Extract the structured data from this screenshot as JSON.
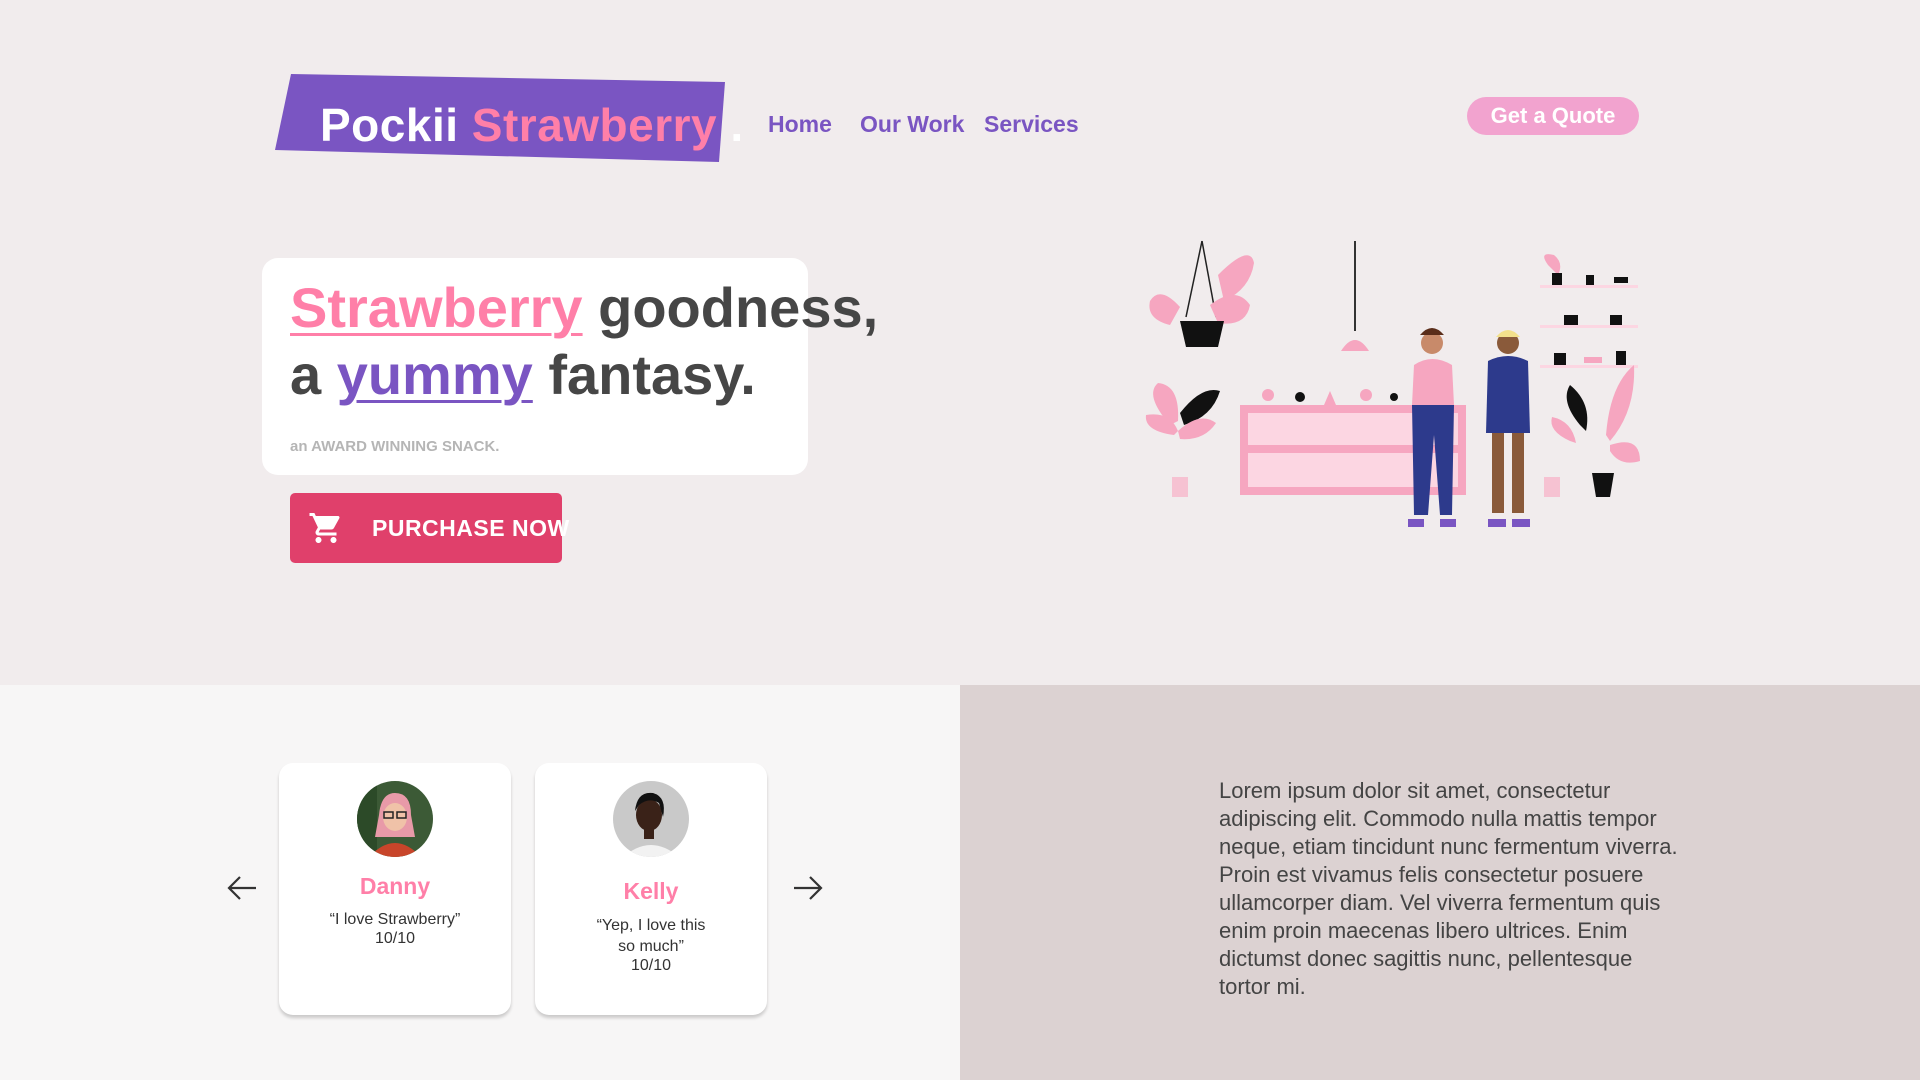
{
  "header": {
    "logo": {
      "part1": "Pockii",
      "part2": "Strawberry",
      "dot": "."
    },
    "nav": [
      "Home",
      "Our Work",
      "Services"
    ],
    "cta": "Get a Quote"
  },
  "hero": {
    "word1": "Strawberry",
    "rest1": " goodness,",
    "word2_prefix": "a ",
    "word2": "yummy",
    "rest2": " fantasy.",
    "subtitle": "an AWARD WINNING SNACK.",
    "button_label": "PURCHASE NOW"
  },
  "testimonials": [
    {
      "name": "Danny",
      "quote": "“I love Strawberry”",
      "score": "10/10"
    },
    {
      "name": "Kelly",
      "quote_line1": "“Yep, I love this",
      "quote_line2": "so much”",
      "score": "10/10"
    }
  ],
  "about": {
    "text": "Lorem ipsum dolor sit amet, consectetur adipiscing elit. Commodo nulla mattis tempor neque, etiam tincidunt nunc fermentum viverra. Proin est vivamus felis consectetur posuere ullamcorper diam. Vel viverra fermentum quis enim proin maecenas libero ultrices. Enim dictumst donec sagittis nunc, pellentesque tortor mi."
  },
  "colors": {
    "background": "#f1eced",
    "brand_purple": "#7a55c2",
    "brand_pink": "#ff7fa8",
    "button_red": "#e0406b",
    "quote_pink": "#f2a3cf"
  },
  "icons": [
    "cart-icon",
    "arrow-left-icon",
    "arrow-right-icon"
  ]
}
